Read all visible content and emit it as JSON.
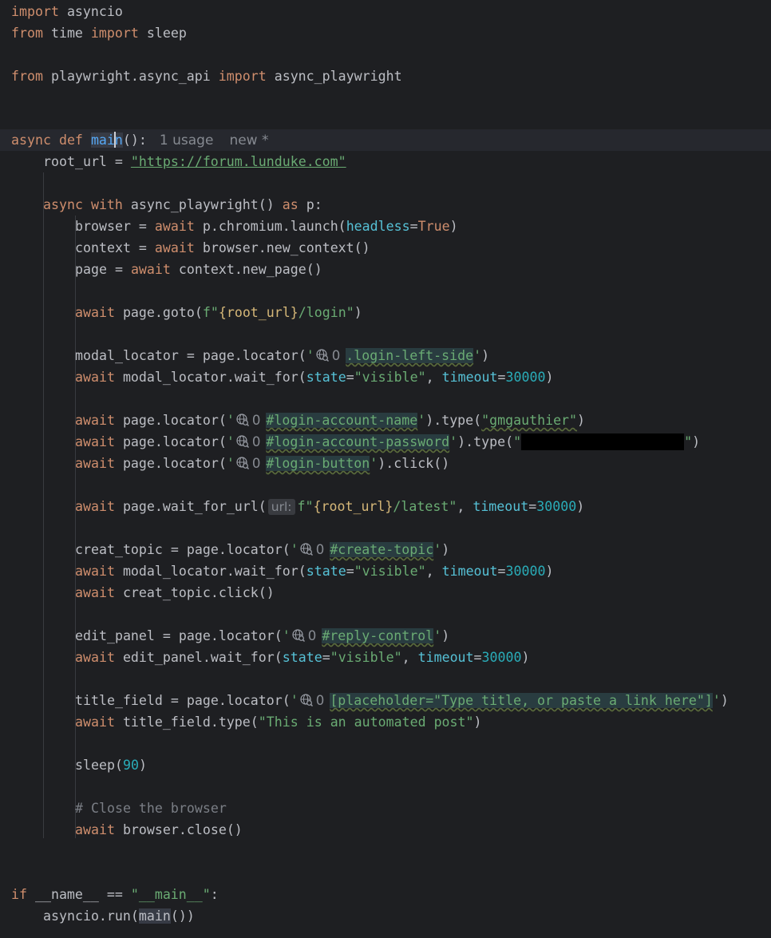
{
  "editor": {
    "language": "python",
    "hints": {
      "usage": "1 usage",
      "new": "new *",
      "locator_count": "0",
      "url_param": "url:"
    },
    "lines": {
      "import_asyncio": [
        "import",
        " asyncio"
      ],
      "from_time": [
        "from",
        " time ",
        "import",
        " sleep"
      ],
      "from_playwright": [
        "from",
        " playwright.async_api ",
        "import",
        " async_playwright"
      ],
      "def_main": [
        "async",
        " ",
        "def",
        " ",
        "mai",
        "n",
        "():"
      ],
      "root_url": [
        "root_url = ",
        "\"https://forum.lunduke.com\""
      ],
      "async_with": [
        "async",
        " ",
        "with",
        " async_playwright() ",
        "as",
        " p:"
      ],
      "browser": [
        "browser = ",
        "await",
        " p.chromium.launch(",
        "headless",
        "=",
        "True",
        ")"
      ],
      "context": [
        "context = ",
        "await",
        " browser.new_context()"
      ],
      "page": [
        "page = ",
        "await",
        " context.new_page()"
      ],
      "goto": [
        "await",
        " page.goto(",
        "f\"",
        "{root_url}",
        "/login\"",
        ")"
      ],
      "modal_locator": [
        "modal_locator = page.locator(",
        "'",
        ".login-left-side",
        "'",
        ")"
      ],
      "modal_wait": [
        "await",
        " modal_locator.wait_for(",
        "state",
        "=",
        "\"visible\"",
        ", ",
        "timeout",
        "=",
        "30000",
        ")"
      ],
      "login_name": [
        "await",
        " page.locator(",
        "'",
        "#login-account-name",
        "'",
        ").type(",
        "\"gmgauthier\"",
        ")"
      ],
      "login_password": [
        "await",
        " page.locator(",
        "'",
        "#login-account-password",
        "'",
        ").type(",
        "\"",
        "\"",
        ")"
      ],
      "login_button": [
        "await",
        " page.locator(",
        "'",
        "#login-button",
        "'",
        ").click()"
      ],
      "wait_for_url": [
        "await",
        " page.wait_for_url(",
        "f\"",
        "{root_url}",
        "/latest\"",
        ", ",
        "timeout",
        "=",
        "30000",
        ")"
      ],
      "creat_topic": [
        "creat_topic = page.locator(",
        "'",
        "#create-topic",
        "'",
        ")"
      ],
      "modal_wait_2": [
        "await",
        " modal_locator.wait_for(",
        "state",
        "=",
        "\"visible\"",
        ", ",
        "timeout",
        "=",
        "30000",
        ")"
      ],
      "creat_click": [
        "await",
        " creat_topic.click()"
      ],
      "edit_panel": [
        "edit_panel = page.locator(",
        "'",
        "#reply-control",
        "'",
        ")"
      ],
      "edit_wait": [
        "await",
        " edit_panel.wait_for(",
        "state",
        "=",
        "\"visible\"",
        ", ",
        "timeout",
        "=",
        "30000",
        ")"
      ],
      "title_field": [
        "title_field = page.locator(",
        "'",
        "[placeholder=\"Type title, or paste a link here\"]",
        "'",
        ")"
      ],
      "title_type": [
        "await",
        " title_field.type(",
        "\"This is an automated post\"",
        ")"
      ],
      "sleep": [
        "sleep(",
        "90",
        ")"
      ],
      "comment": [
        "# Close the browser"
      ],
      "browser_close": [
        "await",
        " browser.close()"
      ],
      "if_main": [
        "if",
        " __name__ == ",
        "\"__main__\"",
        ":"
      ],
      "asyncio_run": [
        "asyncio.run(",
        "main",
        "())"
      ]
    }
  },
  "colors": {
    "background": "#1e1f22",
    "keyword": "#cf8e6d",
    "string": "#6aab73",
    "number": "#2aacb8",
    "function_decl": "#56a8f5",
    "named_arg": "#56c1d6",
    "comment": "#7a7e85",
    "text": "#bcbec4"
  }
}
